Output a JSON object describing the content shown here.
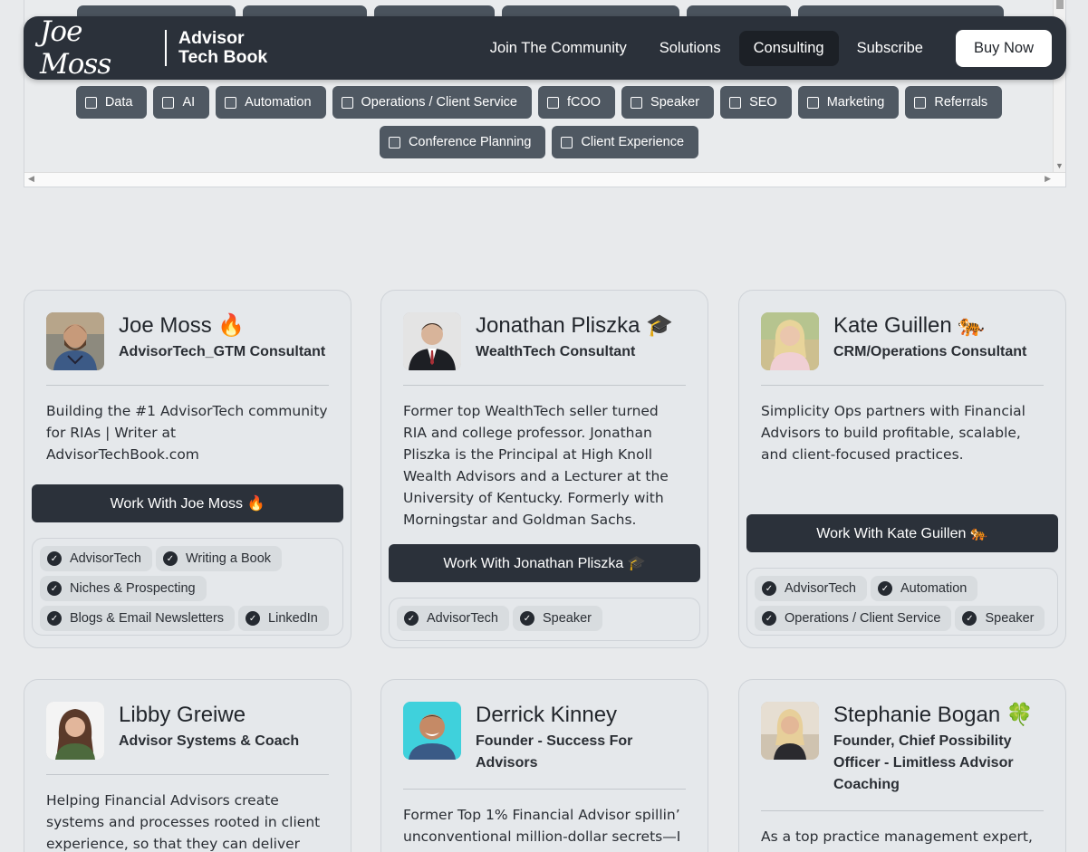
{
  "nav": {
    "logo_script": "Joe Moss",
    "logo_line1": "Advisor",
    "logo_line2": "Tech Book",
    "links": [
      "Join The Community",
      "Solutions",
      "Consulting",
      "Subscribe"
    ],
    "active": "Consulting",
    "buy_label": "Buy Now"
  },
  "filters": {
    "row1": [
      "Data",
      "AI",
      "Automation",
      "Operations / Client Service",
      "fCOO",
      "Speaker",
      "SEO",
      "Marketing",
      "Referrals"
    ],
    "row2": [
      "Conference Planning",
      "Client Experience"
    ]
  },
  "cards": [
    {
      "name": "Joe Moss",
      "emoji": "🔥",
      "role": "AdvisorTech_GTM Consultant",
      "desc": "Building the #1 AdvisorTech community for RIAs | Writer at AdvisorTechBook.com",
      "button": "Work With Joe Moss 🔥",
      "tags": [
        "AdvisorTech",
        "Writing a Book",
        "Niches & Prospecting",
        "Blogs & Email Newsletters",
        "LinkedIn"
      ]
    },
    {
      "name": "Jonathan Pliszka",
      "emoji": "🎓",
      "role": "WealthTech Consultant",
      "desc": "Former top WealthTech seller turned RIA and college professor. Jonathan Pliszka is the Principal at High Knoll Wealth Advisors and a Lecturer at the University of Kentucky. Formerly with Morningstar and Goldman Sachs.",
      "button": "Work With Jonathan Pliszka 🎓",
      "tags": [
        "AdvisorTech",
        "Speaker"
      ]
    },
    {
      "name": "Kate Guillen",
      "emoji": "🐅",
      "role": "CRM/Operations Consultant",
      "desc": "Simplicity Ops partners with Financial Advisors to build profitable, scalable, and client-focused practices.",
      "button": "Work With Kate Guillen 🐅",
      "tags": [
        "AdvisorTech",
        "Automation",
        "Operations / Client Service",
        "Speaker"
      ]
    },
    {
      "name": "Libby Greiwe",
      "emoji": "",
      "role": "Advisor Systems & Coach",
      "desc": "Helping Financial Advisors create systems and processes rooted in client experience, so that they can deliver"
    },
    {
      "name": "Derrick Kinney",
      "emoji": "",
      "role": "Founder - Success For Advisors",
      "desc": "Former Top 1% Financial Advisor spillin’ unconventional million-dollar secrets—I"
    },
    {
      "name": "Stephanie Bogan",
      "emoji": "🍀",
      "role": "Founder, Chief Possibility Officer - Limitless Advisor Coaching",
      "desc": "As a top practice management expert,"
    }
  ]
}
